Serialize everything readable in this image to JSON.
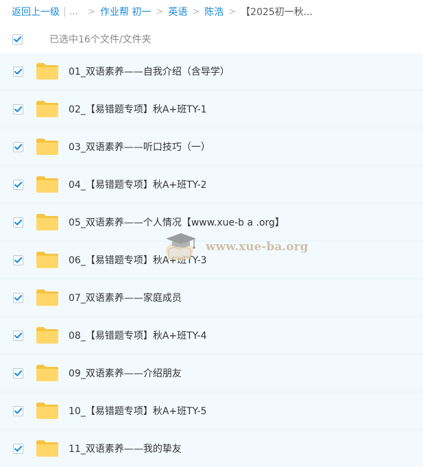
{
  "breadcrumb": {
    "back_label": "返回上一级",
    "ellipsis": "...",
    "items": [
      "作业帮 初一",
      "英语",
      "陈浩"
    ],
    "current": "【2025初一秋..."
  },
  "selection": {
    "checked": true,
    "summary": "已选中16个文件/文件夹"
  },
  "files": [
    {
      "name": "01_双语素养——自我介绍（含导学）",
      "checked": true,
      "icon": "folder-icon"
    },
    {
      "name": "02_【易错题专项】秋A+班TY-1",
      "checked": true,
      "icon": "folder-icon"
    },
    {
      "name": "03_双语素养——听口技巧（一）",
      "checked": true,
      "icon": "folder-icon"
    },
    {
      "name": "04_【易错题专项】秋A+班TY-2",
      "checked": true,
      "icon": "folder-icon"
    },
    {
      "name": "05_双语素养——个人情况【www.xue-b a .org】",
      "checked": true,
      "icon": "folder-icon"
    },
    {
      "name": "06_【易错题专项】秋A+班TY-3",
      "checked": true,
      "icon": "folder-icon"
    },
    {
      "name": "07_双语素养——家庭成员",
      "checked": true,
      "icon": "folder-icon"
    },
    {
      "name": "08_【易错题专项】秋A+班TY-4",
      "checked": true,
      "icon": "folder-icon"
    },
    {
      "name": "09_双语素养——介绍朋友",
      "checked": true,
      "icon": "folder-icon"
    },
    {
      "name": "10_【易错题专项】秋A+班TY-5",
      "checked": true,
      "icon": "folder-icon"
    },
    {
      "name": "11_双语素养——我的挚友",
      "checked": true,
      "icon": "folder-icon"
    }
  ],
  "watermark": {
    "text": "www.xue-ba.org",
    "icon": "graduation-cap-logo"
  },
  "colors": {
    "link": "#1a8ad8",
    "checkbox_check": "#1f8fe0",
    "row_background": "#f2faff",
    "row_divider": "#e2eef6",
    "folder_body": "#ffd768",
    "folder_tab": "#f5c443"
  }
}
